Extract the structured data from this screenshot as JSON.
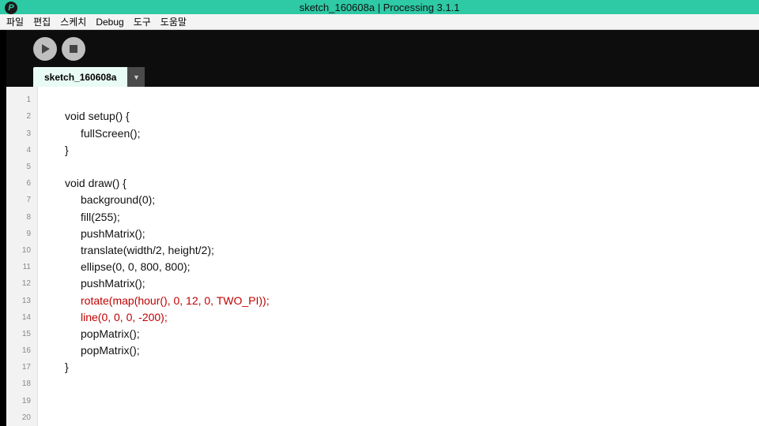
{
  "titlebar": {
    "logo_text": "P",
    "title": "sketch_160608a | Processing 3.1.1"
  },
  "menu": {
    "items": [
      "파일",
      "편집",
      "스케치",
      "Debug",
      "도구",
      "도움말"
    ]
  },
  "toolbar": {
    "run_title": "Run",
    "stop_title": "Stop"
  },
  "tabs": {
    "active_label": "sketch_160608a",
    "dropdown_symbol": "▼"
  },
  "editor": {
    "lines": [
      {
        "n": 1,
        "text": "",
        "cls": ""
      },
      {
        "n": 2,
        "text": "void setup() {",
        "cls": "ind1"
      },
      {
        "n": 3,
        "text": "fullScreen();",
        "cls": "ind2"
      },
      {
        "n": 4,
        "text": "}",
        "cls": "ind1"
      },
      {
        "n": 5,
        "text": "",
        "cls": ""
      },
      {
        "n": 6,
        "text": "void draw() {",
        "cls": "ind1"
      },
      {
        "n": 7,
        "text": "background(0);",
        "cls": "ind2"
      },
      {
        "n": 8,
        "text": "fill(255);",
        "cls": "ind2"
      },
      {
        "n": 9,
        "text": "pushMatrix();",
        "cls": "ind2"
      },
      {
        "n": 10,
        "text": "translate(width/2, height/2);",
        "cls": "ind2"
      },
      {
        "n": 11,
        "text": "ellipse(0, 0, 800, 800);",
        "cls": "ind2"
      },
      {
        "n": 12,
        "text": "pushMatrix();",
        "cls": "ind2"
      },
      {
        "n": 13,
        "text": "rotate(map(hour(), 0, 12, 0, TWO_PI));",
        "cls": "ind2 red"
      },
      {
        "n": 14,
        "text": "line(0, 0, 0, -200);",
        "cls": "ind2 red"
      },
      {
        "n": 15,
        "text": "popMatrix();",
        "cls": "ind2"
      },
      {
        "n": 16,
        "text": "popMatrix();",
        "cls": "ind2"
      },
      {
        "n": 17,
        "text": "}",
        "cls": "ind1"
      },
      {
        "n": 18,
        "text": "",
        "cls": ""
      },
      {
        "n": 19,
        "text": "",
        "cls": ""
      },
      {
        "n": 20,
        "text": "",
        "cls": ""
      }
    ]
  }
}
